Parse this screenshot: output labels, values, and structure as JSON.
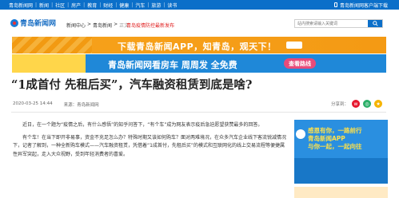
{
  "topbar": {
    "nav": [
      "青岛新闻网",
      "新闻",
      "社区",
      "房产",
      "教育",
      "财经",
      "健康",
      "汽车",
      "旅游",
      "读书"
    ],
    "app_link": "青岛新闻网客户端下载"
  },
  "header": {
    "logo": "青岛新闻网",
    "breadcrumb": [
      "新闻中心",
      "青岛新闻",
      "正文"
    ],
    "alert": "青岛疫情防控最新发布",
    "search_placeholder": "站内搜索请输入关键词"
  },
  "ads": {
    "banner1": "下载青岛新闻APP，知青岛，观天下！",
    "banner2_text": "青岛新闻网看房车 周周发 全免费",
    "banner2_button": "查看路线",
    "side_text": [
      "感恩有你，一路前行",
      "青岛新闻APP",
      "与你一起，一起向往"
    ]
  },
  "article": {
    "title": "“1成首付 先租后买”，汽车融资租赁到底是啥?",
    "date": "2020-03-25 14:44",
    "source": "来源：青岛新闻网",
    "share_label": "分享到：",
    "paragraphs": [
      "近日，在一个题为“疫情之后，有什么感悟”的知乎问答下，“有个车”成为网友表示疫后急迫愿望获赞最多的回答。",
      "有个车！在当下即开非易事，资金不充足怎么办？特殊时期又该如何购车？面对两难境况，在众多汽车企业线下客流锐减情况下，记者了解到，一种全新购车模式——汽车融资租赁，凭借着“1成首付，先租后买”的模式和互联网化的线上交易流程等便捷属性异军突起，走入大众视野，受到年轻消费者的喜爱。"
    ]
  },
  "colors": {
    "brand_blue": "#0b6fc9",
    "alert_red": "#e02020",
    "banner_orange": "#f7a21b"
  }
}
